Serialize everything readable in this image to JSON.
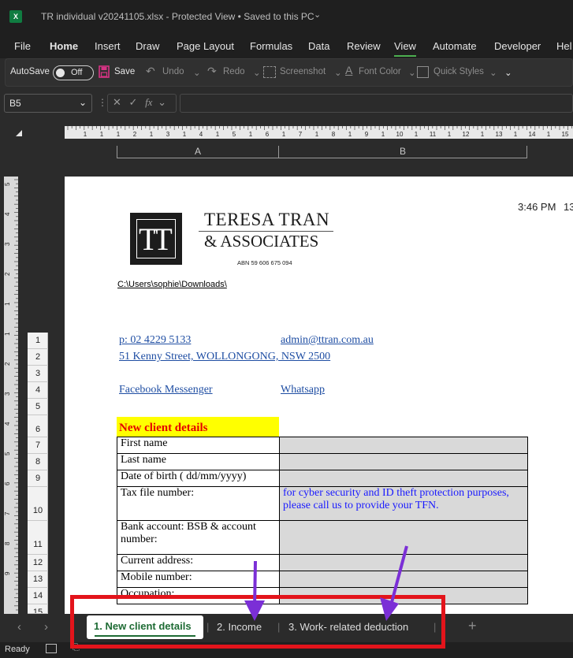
{
  "window": {
    "title": "TR individual v20241105.xlsx  -  Protected View  •  Saved to this PC",
    "app_icon": "X"
  },
  "menu": [
    "File",
    "Home",
    "Insert",
    "Draw",
    "Page Layout",
    "Formulas",
    "Data",
    "Review",
    "View",
    "Automate",
    "Developer",
    "Hel"
  ],
  "ribbon": {
    "autosave_label": "AutoSave",
    "toggle_state": "Off",
    "save_label": "Save",
    "undo_label": "Undo",
    "redo_label": "Redo",
    "screenshot_label": "Screenshot",
    "font_color_label": "Font Color",
    "quick_styles_label": "Quick Styles"
  },
  "formula_bar": {
    "name_box": "B5",
    "fx": "fx"
  },
  "columns": [
    "A",
    "B"
  ],
  "ruler_numbers": [
    "1",
    "1",
    "1",
    "2",
    "1",
    "3",
    "1",
    "4",
    "1",
    "5",
    "1",
    "6",
    "1",
    "7",
    "1",
    "8",
    "1",
    "9",
    "1",
    "10",
    "1",
    "11",
    "1",
    "12",
    "1",
    "13",
    "1",
    "14",
    "1",
    "15"
  ],
  "vruler_numbers": [
    "5",
    "4",
    "3",
    "2",
    "1",
    "1",
    "2",
    "3",
    "4",
    "5",
    "6",
    "7",
    "8",
    "9"
  ],
  "rows": [
    "1",
    "2",
    "3",
    "4",
    "5",
    "6",
    "7",
    "8",
    "9",
    "10",
    "11",
    "12",
    "13",
    "14",
    "15"
  ],
  "document": {
    "time": "3:46 PM",
    "time_extra": "13",
    "logo_line1": "TERESA TRAN",
    "logo_line2": "& ASSOCIATES",
    "abn": "ABN 59 606 675 094",
    "path": "C:\\Users\\sophie\\Downloads\\",
    "phone": "p: 02 4229 5133",
    "email": "admin@ttran.com.au",
    "address": "51 Kenny Street, WOLLONGONG, NSW 2500",
    "facebook": "Facebook Messenger",
    "whatsapp": "Whatsapp",
    "section_title": "New client details",
    "fields": [
      {
        "label": "First name",
        "value": ""
      },
      {
        "label": "Last name",
        "value": ""
      },
      {
        "label": "Date of birth ( dd/mm/yyyy)",
        "value": ""
      },
      {
        "label": "Tax file number:",
        "value": " for cyber security and ID theft protection purposes, please call us to provide your TFN."
      },
      {
        "label": "Bank account: BSB & account number:",
        "value": ""
      },
      {
        "label": "Current address:",
        "value": ""
      },
      {
        "label": "Mobile number:",
        "value": ""
      },
      {
        "label": "Occupation:",
        "value": ""
      }
    ]
  },
  "sheet_tabs": [
    "1. New client details",
    "2. Income",
    "3. Work- related deduction"
  ],
  "status": {
    "ready": "Ready"
  },
  "colors": {
    "accent": "#4caf50",
    "annotation": "#e3141b",
    "arrow": "#7b2fd6",
    "yellow": "#ffff00",
    "title_red": "#e60000"
  }
}
